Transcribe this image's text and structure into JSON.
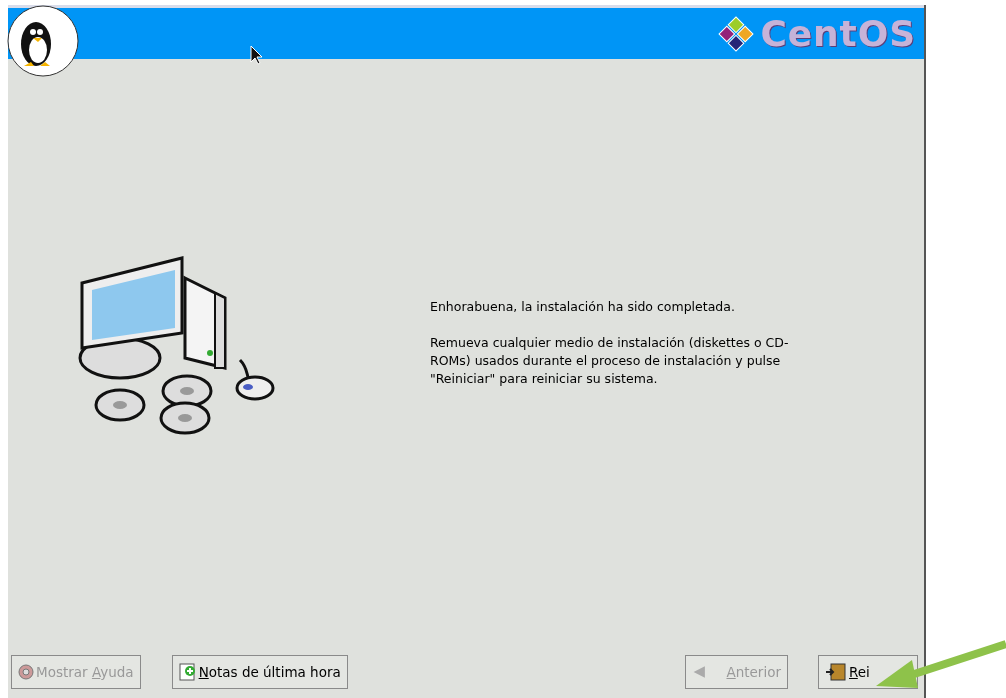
{
  "header": {
    "logo_text": "CentOS"
  },
  "message": {
    "title": "Enhorabuena, la instalación ha sido completada.",
    "body": "Remueva cualquier medio de instalación (diskettes o CD-ROMs) usados durante el proceso de instalación y pulse \"Reiniciar\" para reiniciar su sistema."
  },
  "buttons": [
    {
      "kind": "help",
      "before": "Mostrar ",
      "key": "A",
      "after": "yuda",
      "disabled": true
    },
    {
      "kind": "notes",
      "key": "N",
      "after": "otas de última hora",
      "disabled": false
    },
    {
      "kind": "back",
      "key": "A",
      "after": "nterior",
      "disabled": true
    },
    {
      "kind": "reboot",
      "key": "R",
      "after": "ei",
      "disabled": false
    }
  ]
}
